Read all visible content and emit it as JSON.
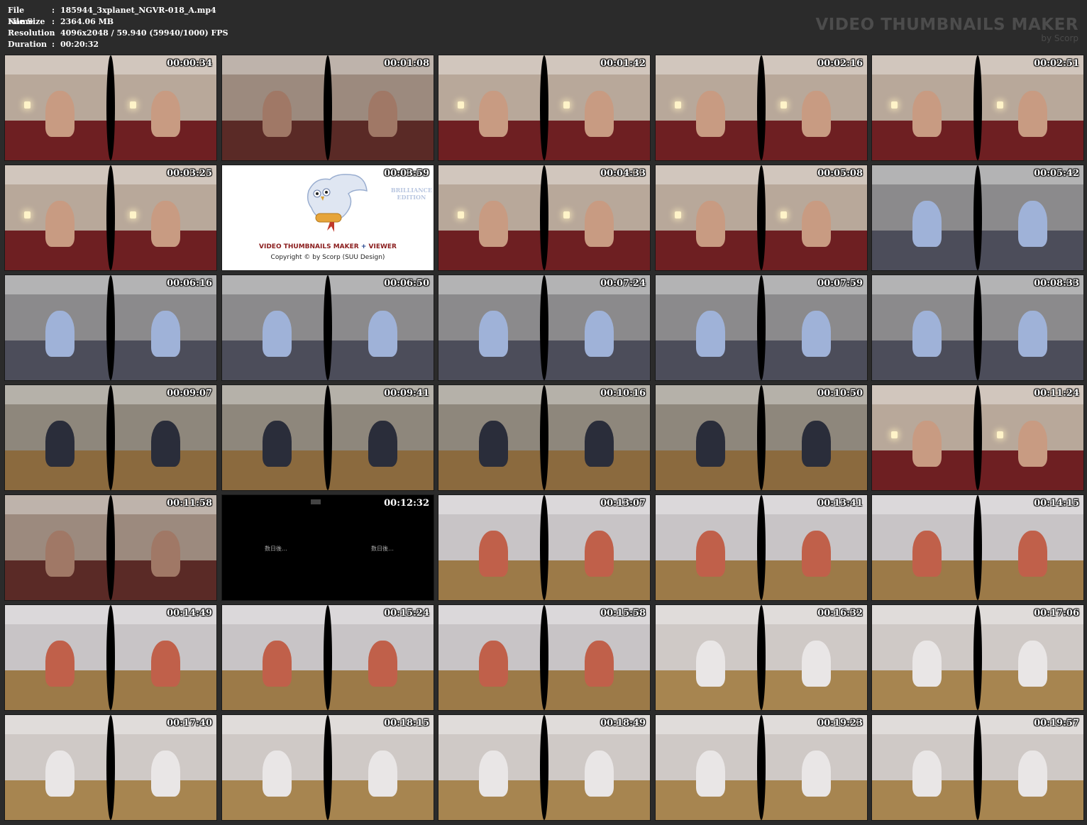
{
  "meta": {
    "rows": [
      {
        "key": "File Name",
        "value": "185944_3xplanet_NGVR-018_A.mp4"
      },
      {
        "key": "File Size",
        "value": "2364.06 MB"
      },
      {
        "key": "Resolution",
        "value": "4096x2048 / 59.940 (59940/1000) FPS"
      },
      {
        "key": "Duration",
        "value": "00:20:32"
      }
    ]
  },
  "brand": {
    "title": "VIDEO THUMBNAILS MAKER",
    "subtitle": "by Scorp"
  },
  "splash": {
    "product_a": "VIDEO THUMBNAILS MAKER",
    "plus": " + ",
    "product_b": "VIEWER",
    "copyright": "Copyright © by Scorp (SUU Design)",
    "edition_1": "BRILLIANCE",
    "edition_2": "EDITION"
  },
  "blank": {
    "caption": "数日後…"
  },
  "thumbnails": [
    {
      "time": "00:00:34",
      "scene": "bedroom"
    },
    {
      "time": "00:01:08",
      "scene": "closeup"
    },
    {
      "time": "00:01:42",
      "scene": "bedroom"
    },
    {
      "time": "00:02:16",
      "scene": "bedroom"
    },
    {
      "time": "00:02:51",
      "scene": "bedroom"
    },
    {
      "time": "00:03:25",
      "scene": "bedroom"
    },
    {
      "time": "00:03:59",
      "scene": "splash"
    },
    {
      "time": "00:04:33",
      "scene": "bedroom"
    },
    {
      "time": "00:05:08",
      "scene": "bedroom"
    },
    {
      "time": "00:05:42",
      "scene": "grey"
    },
    {
      "time": "00:06:16",
      "scene": "grey"
    },
    {
      "time": "00:06:50",
      "scene": "grey"
    },
    {
      "time": "00:07:24",
      "scene": "grey"
    },
    {
      "time": "00:07:59",
      "scene": "grey"
    },
    {
      "time": "00:08:33",
      "scene": "grey"
    },
    {
      "time": "00:09:07",
      "scene": "office"
    },
    {
      "time": "00:09:41",
      "scene": "office"
    },
    {
      "time": "00:10:16",
      "scene": "office"
    },
    {
      "time": "00:10:50",
      "scene": "office"
    },
    {
      "time": "00:11:24",
      "scene": "bedroom"
    },
    {
      "time": "00:11:58",
      "scene": "closeup"
    },
    {
      "time": "00:12:32",
      "scene": "blank"
    },
    {
      "time": "00:13:07",
      "scene": "white"
    },
    {
      "time": "00:13:41",
      "scene": "white"
    },
    {
      "time": "00:14:15",
      "scene": "white"
    },
    {
      "time": "00:14:49",
      "scene": "white"
    },
    {
      "time": "00:15:24",
      "scene": "white"
    },
    {
      "time": "00:15:58",
      "scene": "white"
    },
    {
      "time": "00:16:32",
      "scene": "living"
    },
    {
      "time": "00:17:06",
      "scene": "living"
    },
    {
      "time": "00:17:40",
      "scene": "living"
    },
    {
      "time": "00:18:15",
      "scene": "living"
    },
    {
      "time": "00:18:49",
      "scene": "living"
    },
    {
      "time": "00:19:23",
      "scene": "living"
    },
    {
      "time": "00:19:57",
      "scene": "living"
    }
  ],
  "palette": {
    "bedroom": {
      "wall": "#b8a89a",
      "floor": "#6e1f22",
      "fig": "#c89b82"
    },
    "closeup": {
      "wall": "#9c8a7e",
      "floor": "#5a2a26",
      "fig": "#a07866"
    },
    "grey": {
      "wall": "#8b8a8c",
      "floor": "#4c4d5a",
      "fig": "#9fb2d8"
    },
    "office": {
      "wall": "#8e877c",
      "floor": "#8b6a3e",
      "fig": "#2a2d3a"
    },
    "white": {
      "wall": "#c8c4c6",
      "floor": "#9c7a48",
      "fig": "#c0604a"
    },
    "living": {
      "wall": "#cfc9c6",
      "floor": "#a78550",
      "fig": "#e9e6e6"
    }
  }
}
